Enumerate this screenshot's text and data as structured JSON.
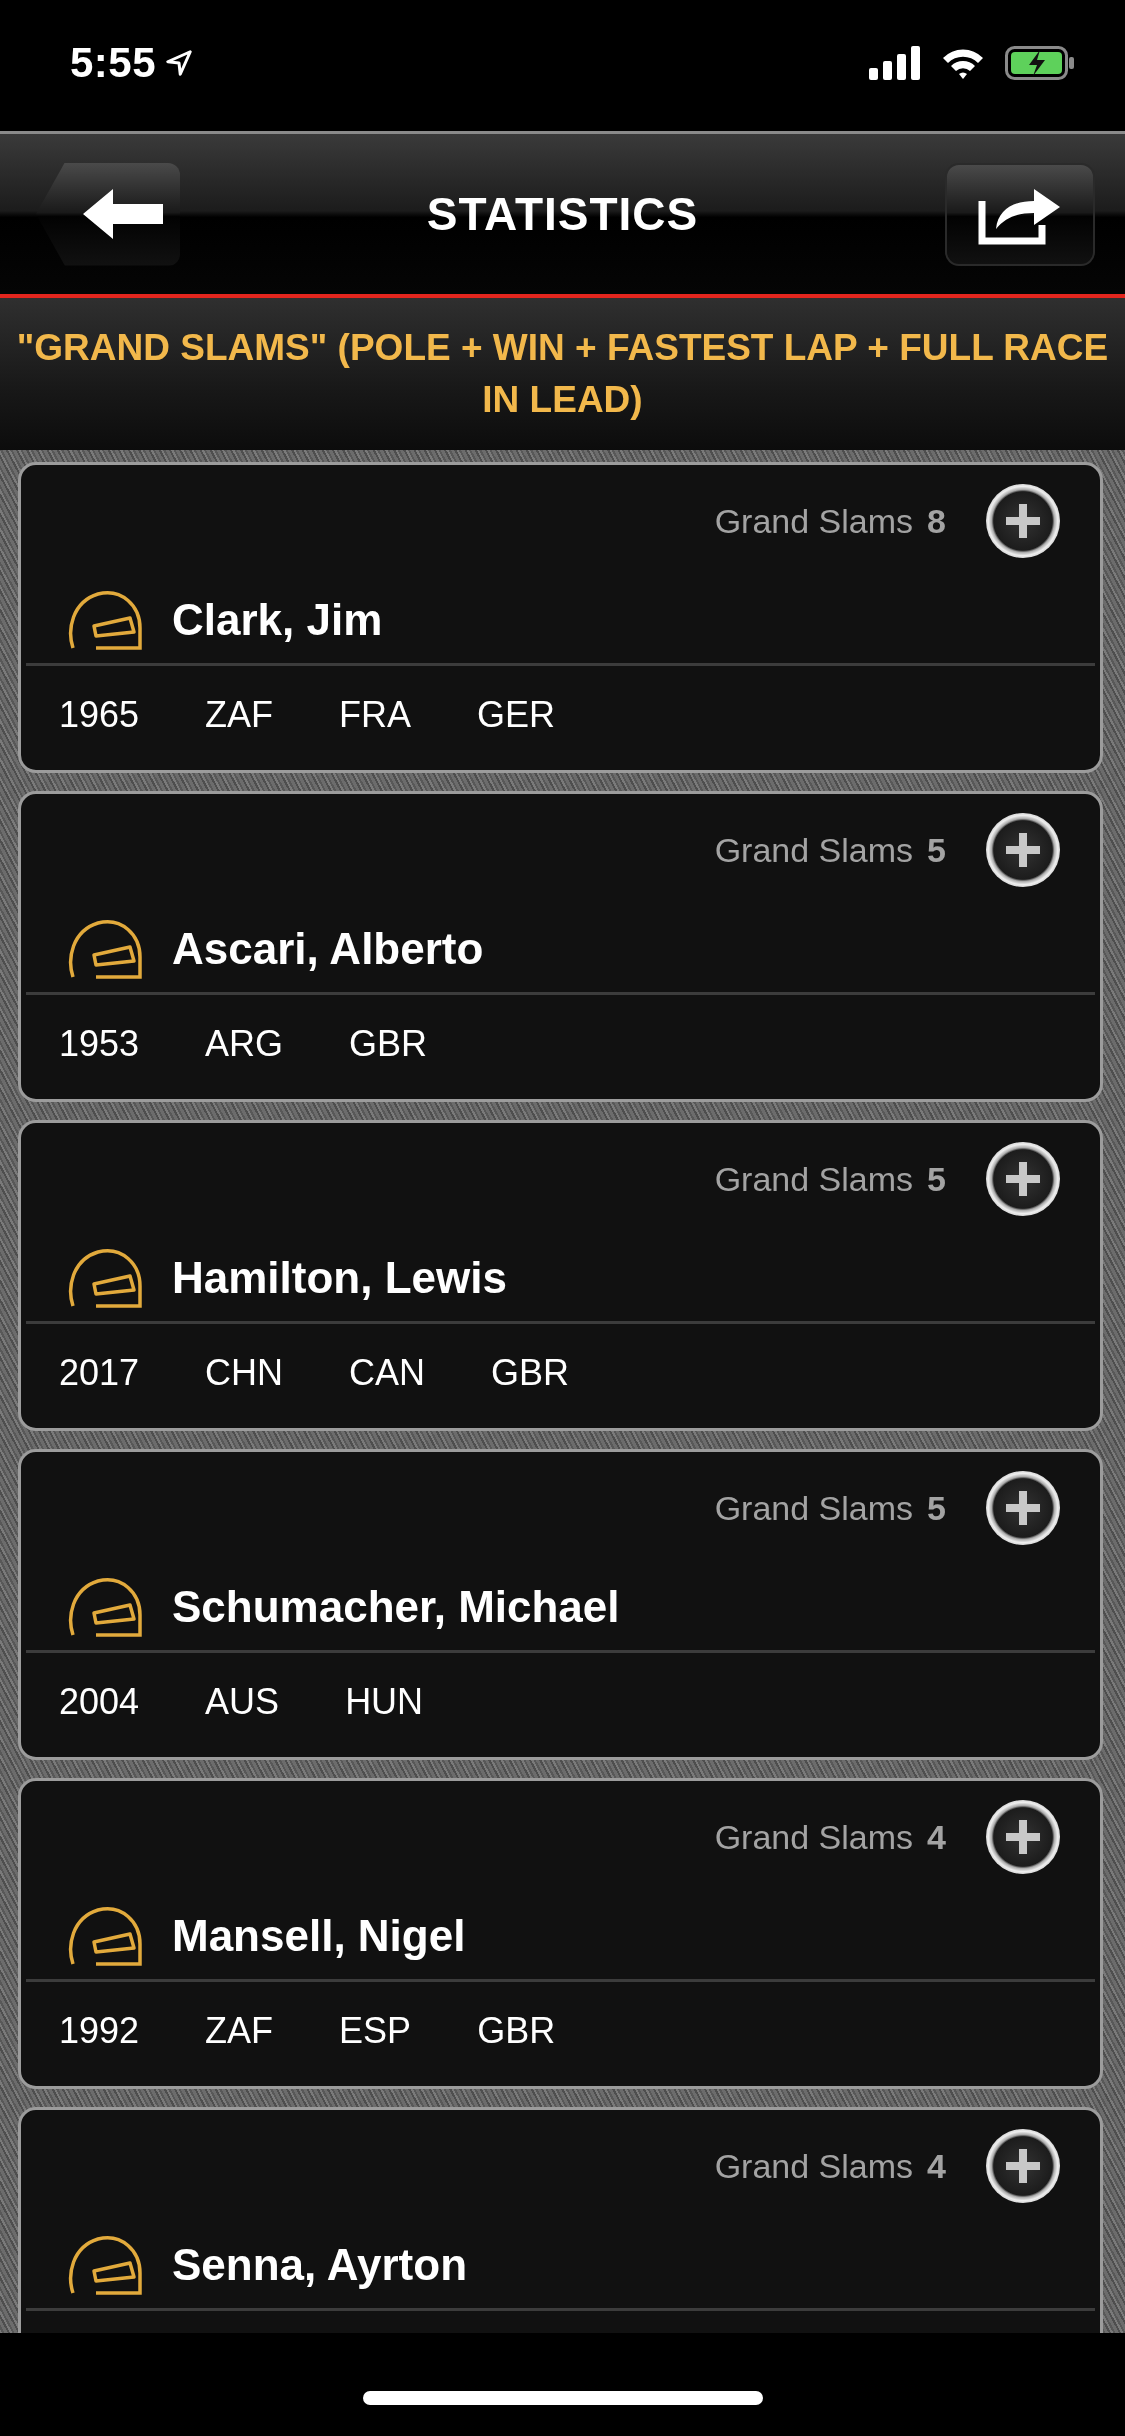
{
  "status_bar": {
    "time": "5:55"
  },
  "header": {
    "title": "STATISTICS"
  },
  "subtitle": "\"GRAND SLAMS\" (POLE + WIN + FASTEST LAP + FULL RACE IN LEAD)",
  "drivers": [
    {
      "stat_label": "Grand Slams",
      "count": "8",
      "name": "Clark, Jim",
      "year": "1965",
      "races": [
        "ZAF",
        "FRA",
        "GER"
      ]
    },
    {
      "stat_label": "Grand Slams",
      "count": "5",
      "name": "Ascari, Alberto",
      "year": "1953",
      "races": [
        "ARG",
        "GBR"
      ]
    },
    {
      "stat_label": "Grand Slams",
      "count": "5",
      "name": "Hamilton, Lewis",
      "year": "2017",
      "races": [
        "CHN",
        "CAN",
        "GBR"
      ]
    },
    {
      "stat_label": "Grand Slams",
      "count": "5",
      "name": "Schumacher, Michael",
      "year": "2004",
      "races": [
        "AUS",
        "HUN"
      ]
    },
    {
      "stat_label": "Grand Slams",
      "count": "4",
      "name": "Mansell, Nigel",
      "year": "1992",
      "races": [
        "ZAF",
        "ESP",
        "GBR"
      ]
    },
    {
      "stat_label": "Grand Slams",
      "count": "4",
      "name": "Senna, Ayrton"
    }
  ]
}
